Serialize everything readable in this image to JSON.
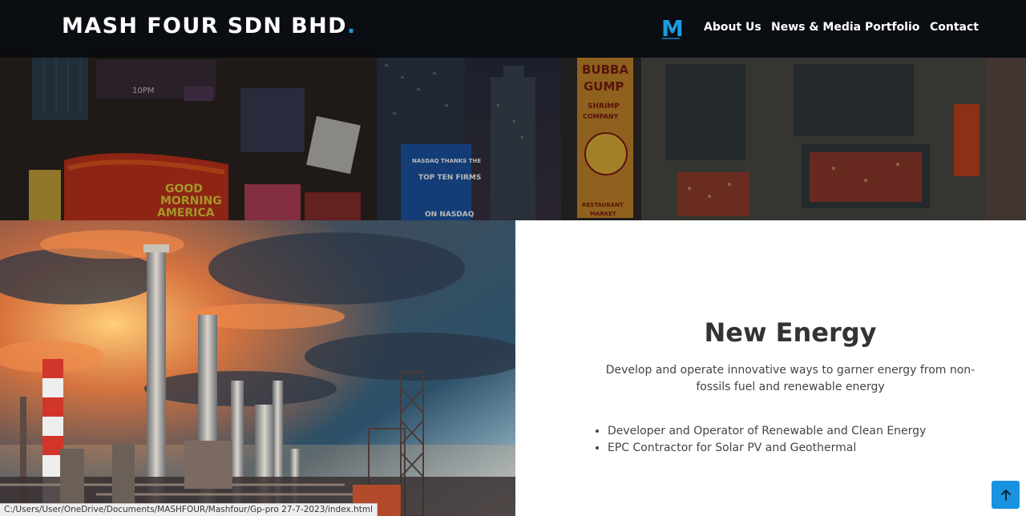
{
  "brand": {
    "name": "MASH FOUR SDN BHD",
    "dot": ".",
    "logo_letter": "M",
    "logo_icon": "mash-four-logo-icon"
  },
  "nav": {
    "items": [
      {
        "label": "About Us"
      },
      {
        "label": "News & Media"
      },
      {
        "label": "Portfolio"
      },
      {
        "label": "Contact"
      }
    ]
  },
  "hero": {
    "signs": {
      "gump_1": "BUBBA",
      "gump_2": "GUMP",
      "gump_3": "SHRIMP",
      "gump_4": "COMPANY",
      "gump_5": "RESTAURANT",
      "gump_6": "MARKET",
      "gma_1": "GOOD",
      "gma_2": "MORNING",
      "gma_3": "AMERICA",
      "nasdaq_1": "NASDAQ THANKS THE",
      "nasdaq_2": "TOP TEN FIRMS",
      "nasdaq_3": "ON NASDAQ",
      "billboard_time": "10PM"
    }
  },
  "section": {
    "title": "New Energy",
    "description": "Develop and operate innovative ways to garner energy from non-fossils fuel and renewable energy",
    "bullets": [
      "Developer and Operator of Renewable and Clean Energy",
      "EPC Contractor for Solar PV and Geothermal"
    ]
  },
  "status_bar": {
    "url": "C:/Users/User/OneDrive/Documents/MASHFOUR/Mashfour/Gp-pro 27-7-2023/index.html"
  },
  "back_to_top": {
    "icon": "arrow-up-icon"
  },
  "colors": {
    "accent": "#1a9be0",
    "button": "#1992e0",
    "navbar": "#08090e"
  }
}
